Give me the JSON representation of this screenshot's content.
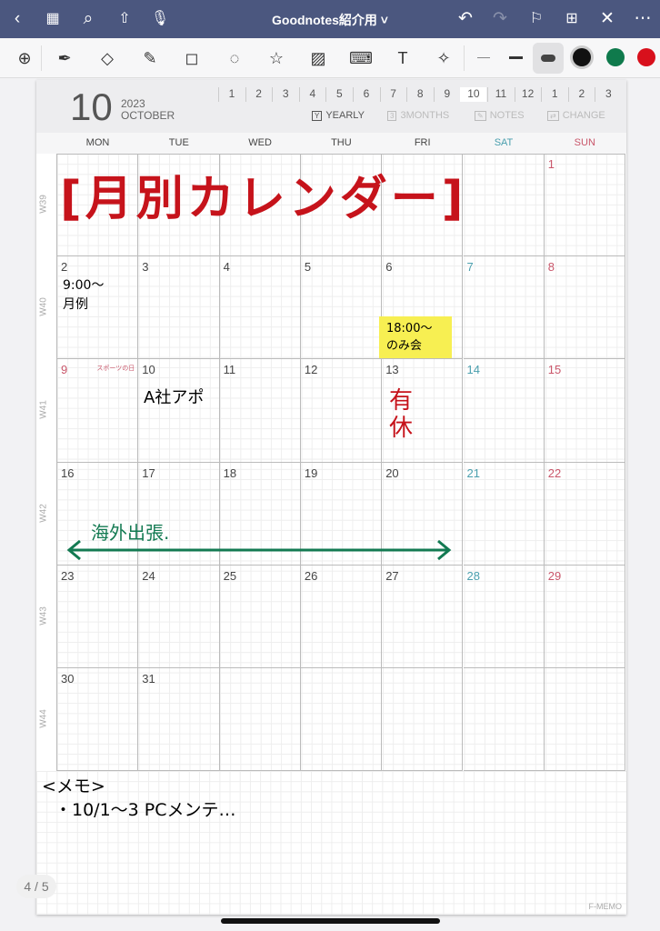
{
  "topbar": {
    "title": "Goodnotes紹介用 ˅",
    "icons": [
      "back-icon",
      "grid-icon",
      "search-icon",
      "share-icon",
      "microphone-icon",
      "undo-icon",
      "redo-icon",
      "bookmark-icon",
      "add-page-icon",
      "close-icon",
      "more-icon"
    ]
  },
  "toolbar": {
    "tools": [
      "zoom-window",
      "pen",
      "eraser",
      "highlighter",
      "shapes",
      "lasso",
      "elements",
      "image",
      "keyboard",
      "text",
      "laser-pointer"
    ],
    "colors": [
      "#111111",
      "#0f7a4c",
      "#d8101c"
    ]
  },
  "calendar": {
    "month_num": "10",
    "year": "2023",
    "month_name": "OCTOBER",
    "month_tabs": [
      "1",
      "2",
      "3",
      "4",
      "5",
      "6",
      "7",
      "8",
      "9",
      "10",
      "11",
      "12",
      "1",
      "2",
      "3"
    ],
    "active_month_index": 9,
    "views": [
      {
        "label": "YEARLY",
        "icon": "Y",
        "active": true
      },
      {
        "label": "3MONTHS",
        "icon": "3",
        "active": false
      },
      {
        "label": "NOTES",
        "icon": "✎",
        "active": false
      },
      {
        "label": "CHANGE",
        "icon": "⇄",
        "active": false
      }
    ],
    "weekdays": [
      "MON",
      "TUE",
      "WED",
      "THU",
      "FRI",
      "SAT",
      "SUN"
    ],
    "weekday_colors": {
      "sat": "#4a9fae",
      "sun": "#c9566a",
      "normal": "#444444"
    },
    "weeks": [
      {
        "label": "W39",
        "days": [
          "",
          "",
          "",
          "",
          "",
          "",
          "1"
        ]
      },
      {
        "label": "W40",
        "days": [
          "2",
          "3",
          "4",
          "5",
          "6",
          "7",
          "8"
        ]
      },
      {
        "label": "W41",
        "days": [
          "9",
          "10",
          "11",
          "12",
          "13",
          "14",
          "15"
        ]
      },
      {
        "label": "W42",
        "days": [
          "16",
          "17",
          "18",
          "19",
          "20",
          "21",
          "22"
        ]
      },
      {
        "label": "W43",
        "days": [
          "23",
          "24",
          "25",
          "26",
          "27",
          "28",
          "29"
        ]
      },
      {
        "label": "W44",
        "days": [
          "30",
          "31",
          "",
          "",
          "",
          "",
          ""
        ]
      }
    ],
    "holiday": {
      "day": "9",
      "label": "スポーツの日"
    }
  },
  "handwriting": {
    "title": "[月別カレンダー]",
    "oct2": "9:00〜\n月例",
    "oct6": "18:00〜\nのみ会",
    "oct10": "A社アポ",
    "oct13": "有\n休",
    "trip": "海外出張.",
    "memo_title": "<メモ>",
    "memo_line": "・10/1〜3 PCメンテ…"
  },
  "footer": {
    "page_indicator": "4 / 5",
    "brand": "F-MEMO"
  }
}
